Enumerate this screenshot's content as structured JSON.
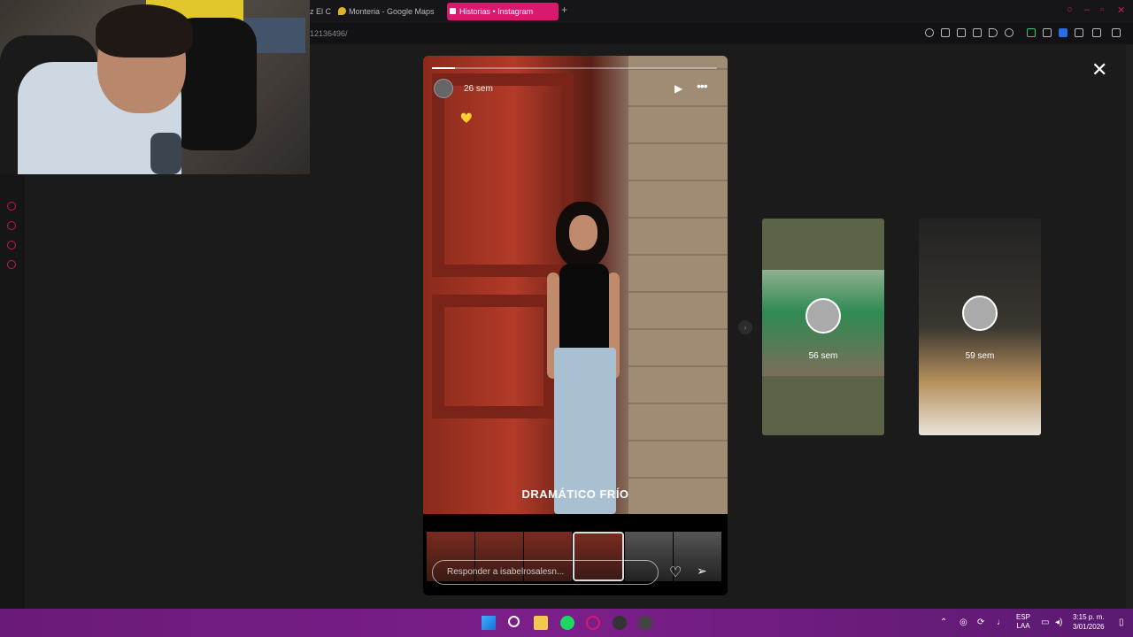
{
  "browser": {
    "tabs": [
      {
        "label": "Monteria - Google Maps",
        "partial_prev": "z El C"
      },
      {
        "label": "Historias • Instagram"
      }
    ],
    "url": "12136496/",
    "new_tab": "+"
  },
  "story": {
    "time": "26 sem",
    "caption": "DRAMÁTICO FRÍO",
    "reply_placeholder": "Responder a isabelrosalesn...",
    "play": "▶",
    "more": "•••",
    "close": "✕",
    "heart_emoji": "💛",
    "progress": 0.08
  },
  "next_stories": [
    {
      "time": "56 sem"
    },
    {
      "time": "59 sem"
    }
  ],
  "taskbar": {
    "lang_line1": "ESP",
    "lang_line2": "LAA",
    "time": "3:15 p. m.",
    "date": "3/01/2026"
  },
  "colors": {
    "accent": "#d8196e",
    "opera": "#c2184d"
  }
}
